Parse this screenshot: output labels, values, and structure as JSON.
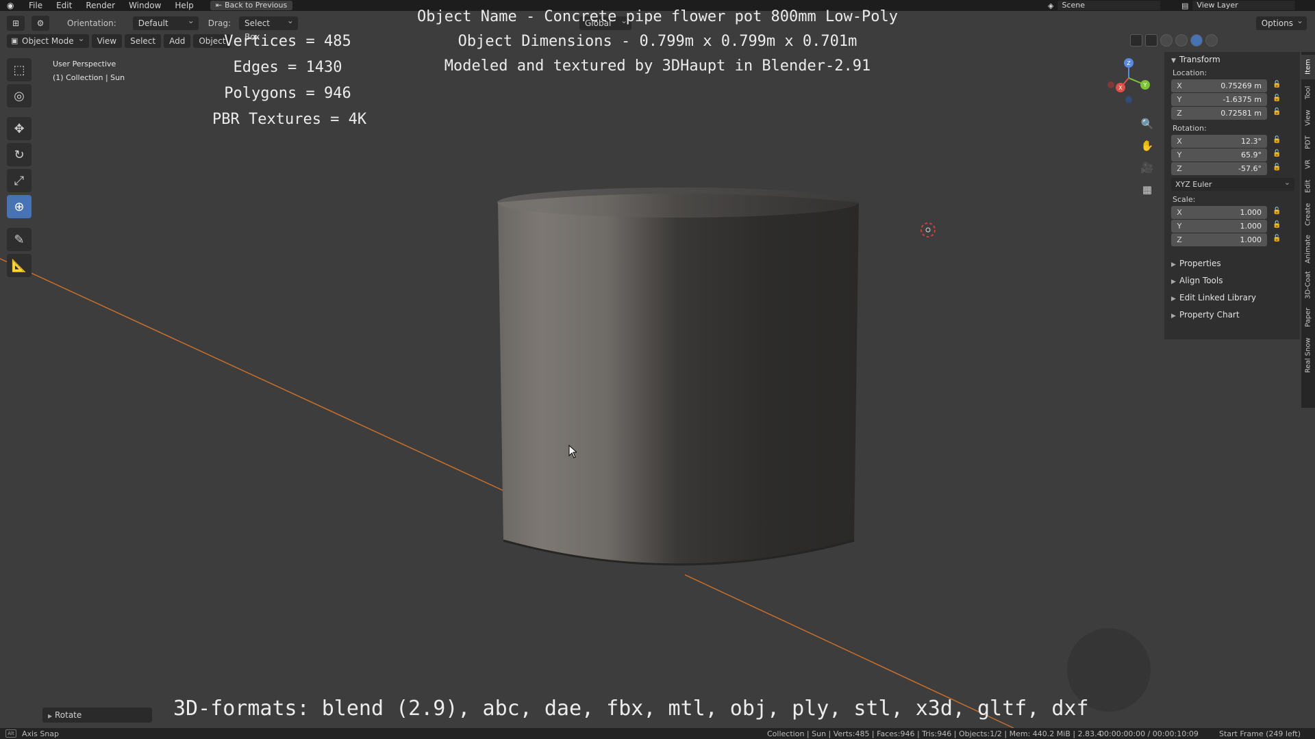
{
  "menu": {
    "items": [
      "File",
      "Edit",
      "Render",
      "Window",
      "Help"
    ],
    "back_button": "Back to Previous",
    "scene": "Scene",
    "view_layer": "View Layer"
  },
  "header": {
    "orientation_label": "Orientation:",
    "orientation_value": "Default",
    "drag_label": "Drag:",
    "drag_value": "Select Box",
    "transform_orientation": "Global",
    "options": "Options"
  },
  "header2": {
    "mode": "Object Mode",
    "items": [
      "View",
      "Select",
      "Add",
      "Object"
    ]
  },
  "viewport": {
    "perspective": "User Perspective",
    "collection": "(1) Collection | Sun"
  },
  "overlay": {
    "vertices": "Vertices = 485",
    "edges": "Edges = 1430",
    "polygons": "Polygons = 946",
    "textures": "PBR Textures = 4K",
    "object_name": "Object Name - Concrete pipe flower pot 800mm Low-Poly",
    "object_dimensions": "Object Dimensions -  0.799m x 0.799m x 0.701m",
    "credit": "Modeled and textured by 3DHaupt in Blender-2.91",
    "formats": "3D-formats: blend (2.9), abc, dae, fbx, mtl, obj, ply, stl, x3d, gltf, dxf"
  },
  "gizmo": {
    "z": "Z",
    "x": "X",
    "y": "Y"
  },
  "npanel": {
    "transform": "Transform",
    "location_label": "Location:",
    "location": [
      {
        "axis": "X",
        "value": "0.75269 m"
      },
      {
        "axis": "Y",
        "value": "-1.6375 m"
      },
      {
        "axis": "Z",
        "value": "0.72581 m"
      }
    ],
    "rotation_label": "Rotation:",
    "rotation": [
      {
        "axis": "X",
        "value": "12.3°"
      },
      {
        "axis": "Y",
        "value": "65.9°"
      },
      {
        "axis": "Z",
        "value": "-57.6°"
      }
    ],
    "rotation_mode": "XYZ Euler",
    "scale_label": "Scale:",
    "scale": [
      {
        "axis": "X",
        "value": "1.000"
      },
      {
        "axis": "Y",
        "value": "1.000"
      },
      {
        "axis": "Z",
        "value": "1.000"
      }
    ],
    "sections": [
      "Properties",
      "Align Tools",
      "Edit Linked Library",
      "Property Chart"
    ]
  },
  "vtabs": [
    "Item",
    "Tool",
    "View",
    "PDT",
    "VR",
    "Edit",
    "Create",
    "Animate",
    "3D-Coat",
    "Paper",
    "Real Snow"
  ],
  "last_op": "Rotate",
  "statusbar": {
    "snap": "Axis Snap",
    "key": "Alt",
    "stats": "Collection | Sun | Verts:485 | Faces:946 | Tris:946 | Objects:1/2 | Mem: 440.2 MiB | 2.83.4",
    "time": "00:00:00:00 / 00:00:10:09",
    "frame": "Start Frame (249 left)"
  },
  "colors": {
    "accent": "#4772b3",
    "axis_line": "#c8702d",
    "background": "#3d3d3d"
  }
}
